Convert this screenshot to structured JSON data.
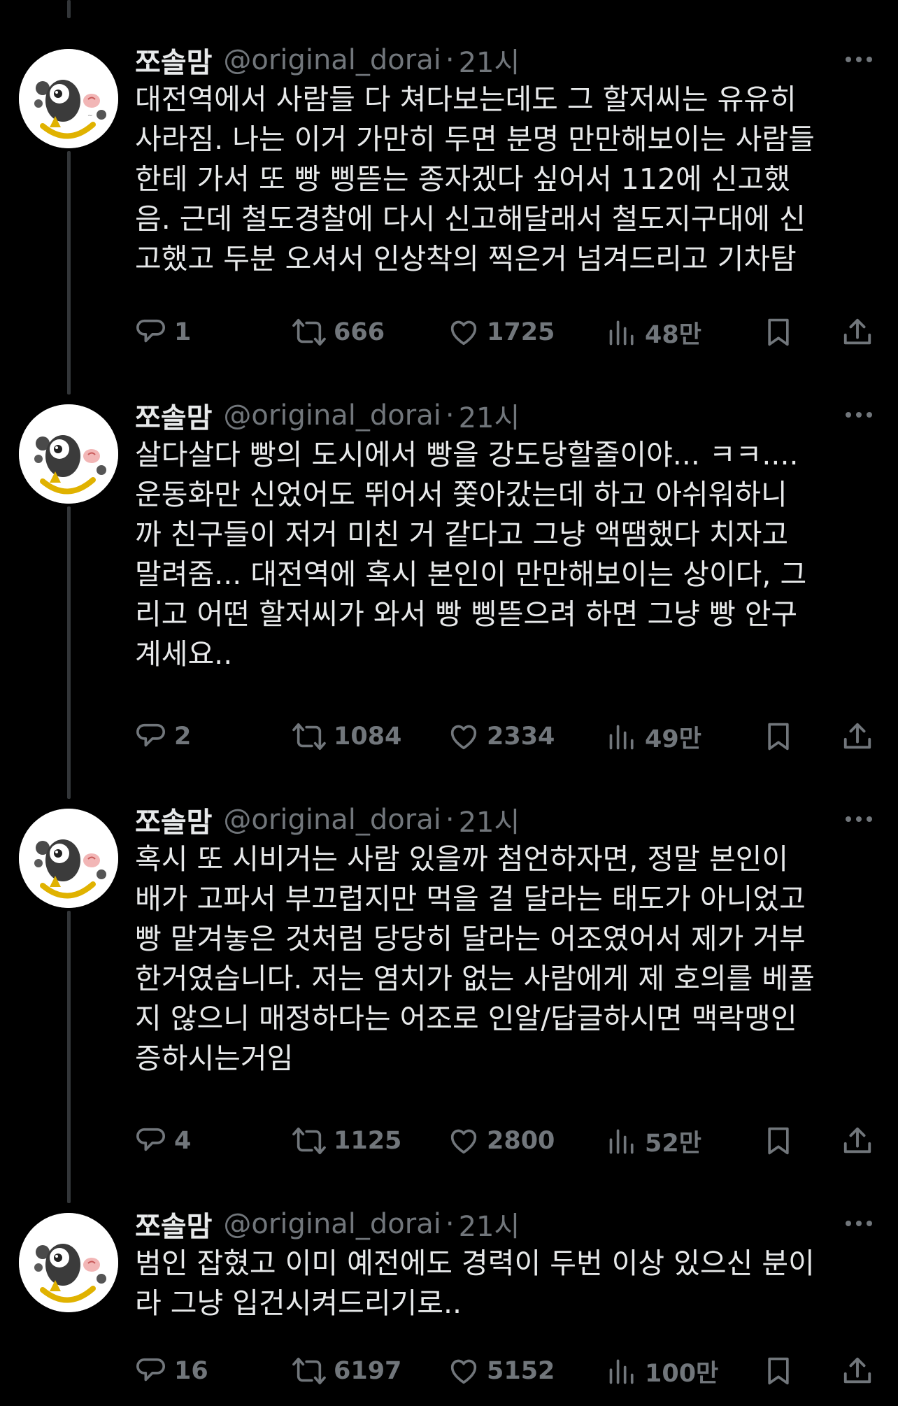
{
  "tweets": [
    {
      "author": {
        "name": "쪼솔맘",
        "handle": "@original_dorai"
      },
      "separator": "·",
      "time": "21시",
      "lines": [
        "대전역에서 사람들 다 쳐다보는데도 그 할저씨는 유유히",
        "사라짐. 나는 이거 가만히 두면 분명 만만해보이는 사람들",
        "한테 가서 또 빵 삥뜯는 종자겠다 싶어서 112에 신고했",
        "음. 근데 철도경찰에 다시 신고해달래서 철도지구대에 신",
        "고했고 두분 오셔서 인상착의 찍은거 넘겨드리고 기차탐"
      ],
      "stats": {
        "replies": "1",
        "retweets": "666",
        "likes": "1725",
        "views": "48만"
      }
    },
    {
      "author": {
        "name": "쪼솔맘",
        "handle": "@original_dorai"
      },
      "separator": "·",
      "time": "21시",
      "lines": [
        "살다살다 빵의 도시에서 빵을 강도당할줄이야... ㅋㅋ....",
        "운동화만 신었어도 뛰어서 쫓아갔는데 하고 아쉬워하니",
        "까 친구들이 저거 미친 거 같다고 그냥 액땜했다 치자고",
        "말려줌... 대전역에 혹시 본인이 만만해보이는 상이다, 그",
        "리고 어떤 할저씨가 와서 빵 삥뜯으려 하면 그냥 빵 안구",
        "계세요.."
      ],
      "stats": {
        "replies": "2",
        "retweets": "1084",
        "likes": "2334",
        "views": "49만"
      }
    },
    {
      "author": {
        "name": "쪼솔맘",
        "handle": "@original_dorai"
      },
      "separator": "·",
      "time": "21시",
      "lines": [
        "혹시 또 시비거는 사람 있을까 첨언하자면, 정말 본인이",
        "배가 고파서 부끄럽지만 먹을 걸 달라는 태도가 아니었고",
        "빵 맡겨놓은 것처럼 당당히 달라는 어조였어서 제가 거부",
        "한거였습니다. 저는 염치가 없는 사람에게 제 호의를 베풀",
        "지 않으니 매정하다는 어조로 인알/답글하시면 맥락맹인",
        "증하시는거임"
      ],
      "stats": {
        "replies": "4",
        "retweets": "1125",
        "likes": "2800",
        "views": "52만"
      }
    },
    {
      "author": {
        "name": "쪼솔맘",
        "handle": "@original_dorai"
      },
      "separator": "·",
      "time": "21시",
      "lines": [
        "범인 잡혔고 이미 예전에도 경력이 두번 이상 있으신 분이",
        "라 그냥 입건시켜드리기로.."
      ],
      "stats": {
        "replies": "16",
        "retweets": "6197",
        "likes": "5152",
        "views": "100만"
      }
    }
  ],
  "icons": {
    "more": "more-dots-icon",
    "reply": "reply-bubble-icon",
    "retweet": "retweet-icon",
    "like": "heart-icon",
    "views": "views-chart-icon",
    "bookmark": "bookmark-icon",
    "share": "share-icon"
  },
  "colors": {
    "background": "#000000",
    "text": "#e7e9ea",
    "muted": "#71767b",
    "thread_line": "#333639"
  }
}
